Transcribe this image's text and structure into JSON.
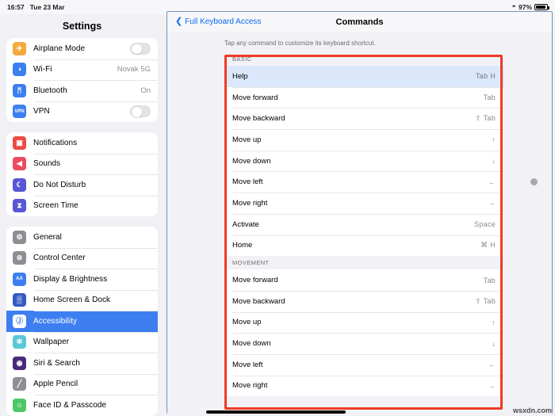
{
  "status_bar": {
    "time": "16:57",
    "date": "Tue 23 Mar",
    "wifi_icon": "wifi-icon",
    "battery_percent": "97%",
    "battery_icon": "battery-icon"
  },
  "sidebar": {
    "title": "Settings",
    "groups": [
      {
        "items": [
          {
            "label": "Airplane Mode",
            "icon": "airplane-icon",
            "icon_glyph": "✈",
            "icon_color": "#f5a93c",
            "control": "toggle",
            "value": ""
          },
          {
            "label": "Wi-Fi",
            "icon": "wifi-icon",
            "icon_glyph": "◑",
            "icon_color": "#3d7ff0",
            "control": "value",
            "value": "Novak 5G"
          },
          {
            "label": "Bluetooth",
            "icon": "bluetooth-icon",
            "icon_glyph": "ᛗ",
            "icon_color": "#3d7ff0",
            "control": "value",
            "value": "On"
          },
          {
            "label": "VPN",
            "icon": "vpn-icon",
            "icon_glyph": "VPN",
            "icon_color": "#3d7ff0",
            "control": "toggle",
            "value": ""
          }
        ]
      },
      {
        "items": [
          {
            "label": "Notifications",
            "icon": "notifications-icon",
            "icon_glyph": "▣",
            "icon_color": "#eb4b42",
            "control": "none",
            "value": ""
          },
          {
            "label": "Sounds",
            "icon": "sounds-icon",
            "icon_glyph": "◀",
            "icon_color": "#eb4b5f",
            "control": "none",
            "value": ""
          },
          {
            "label": "Do Not Disturb",
            "icon": "moon-icon",
            "icon_glyph": "☾",
            "icon_color": "#5856d6",
            "control": "none",
            "value": ""
          },
          {
            "label": "Screen Time",
            "icon": "hourglass-icon",
            "icon_glyph": "⧗",
            "icon_color": "#5856d6",
            "control": "none",
            "value": ""
          }
        ]
      },
      {
        "items": [
          {
            "label": "General",
            "icon": "gear-icon",
            "icon_glyph": "⚙",
            "icon_color": "#8e8e93",
            "control": "none",
            "value": ""
          },
          {
            "label": "Control Center",
            "icon": "sliders-icon",
            "icon_glyph": "⊜",
            "icon_color": "#8e8e93",
            "control": "none",
            "value": ""
          },
          {
            "label": "Display & Brightness",
            "icon": "display-icon",
            "icon_glyph": "AA",
            "icon_color": "#3d7ff0",
            "control": "none",
            "value": ""
          },
          {
            "label": "Home Screen & Dock",
            "icon": "home-screen-icon",
            "icon_glyph": "▒",
            "icon_color": "#3659c4",
            "control": "none",
            "value": ""
          },
          {
            "label": "Accessibility",
            "icon": "accessibility-icon",
            "icon_glyph": "Ⓙ",
            "icon_color": "#1b6ae0",
            "control": "none",
            "value": "",
            "selected": true
          },
          {
            "label": "Wallpaper",
            "icon": "wallpaper-icon",
            "icon_glyph": "✻",
            "icon_color": "#5ac8d8",
            "control": "none",
            "value": ""
          },
          {
            "label": "Siri & Search",
            "icon": "siri-icon",
            "icon_glyph": "◉",
            "icon_color": "#4b2a7a",
            "control": "none",
            "value": ""
          },
          {
            "label": "Apple Pencil",
            "icon": "pencil-icon",
            "icon_glyph": "╱",
            "icon_color": "#8e8e93",
            "control": "none",
            "value": ""
          },
          {
            "label": "Face ID & Passcode",
            "icon": "face-id-icon",
            "icon_glyph": "☺",
            "icon_color": "#4cc764",
            "control": "none",
            "value": ""
          }
        ]
      }
    ]
  },
  "detail": {
    "back_label": "Full Keyboard Access",
    "back_icon": "chevron-left-icon",
    "title": "Commands",
    "hint": "Tap any command to customize its keyboard shortcut.",
    "sections": [
      {
        "header": "BASIC",
        "commands": [
          {
            "label": "Help",
            "key": "Tab H",
            "highlighted": true
          },
          {
            "label": "Move forward",
            "key": "Tab"
          },
          {
            "label": "Move backward",
            "key": "⇧ Tab"
          },
          {
            "label": "Move up",
            "key": "↑"
          },
          {
            "label": "Move down",
            "key": "↓"
          },
          {
            "label": "Move left",
            "key": "←"
          },
          {
            "label": "Move right",
            "key": "→"
          },
          {
            "label": "Activate",
            "key": "Space"
          },
          {
            "label": "Home",
            "key": "⌘ H"
          }
        ]
      },
      {
        "header": "MOVEMENT",
        "commands": [
          {
            "label": "Move forward",
            "key": "Tab"
          },
          {
            "label": "Move backward",
            "key": "⇧ Tab"
          },
          {
            "label": "Move up",
            "key": "↑"
          },
          {
            "label": "Move down",
            "key": "↓"
          },
          {
            "label": "Move left",
            "key": "←"
          },
          {
            "label": "Move right",
            "key": "→"
          }
        ]
      }
    ]
  },
  "annotation": {
    "highlight_color": "#ef3b24"
  },
  "watermark": "wsxdn.com"
}
